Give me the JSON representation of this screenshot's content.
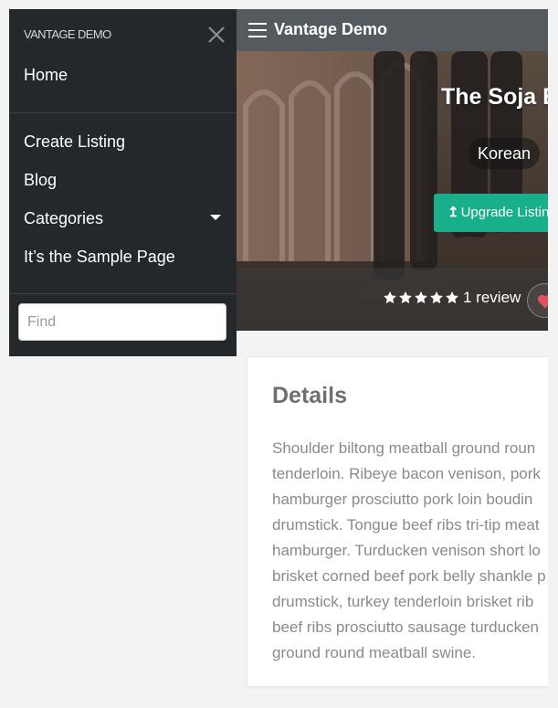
{
  "drawer": {
    "brand": "VANTAGE DEMO",
    "nav": {
      "home": "Home",
      "create_listing": "Create Listing",
      "blog": "Blog",
      "categories": "Categories",
      "sample_page": "It’s the Sample Page"
    },
    "search": {
      "placeholder": "Find",
      "value": ""
    }
  },
  "topbar": {
    "title": "Vantage Demo"
  },
  "listing": {
    "title": "The Soja B",
    "category": "Korean",
    "upgrade_label": "Upgrade Listin",
    "rating": 5,
    "review_count": "1 review"
  },
  "details": {
    "title": "Details",
    "lines": [
      "Shoulder biltong meatball ground roun",
      "tenderloin. Ribeye bacon venison, pork",
      "hamburger prosciutto pork loin boudin",
      "drumstick. Tongue beef ribs tri-tip meat",
      "hamburger. Turducken venison short lo",
      "brisket corned beef pork belly shankle p",
      "drumstick, turkey tenderloin brisket rib",
      "beef ribs prosciutto sausage turducken",
      "ground round meatball swine."
    ]
  },
  "colors": {
    "drawer_bg": "#24282b",
    "topbar_bg": "#555a5f",
    "accent": "#1aaf8b",
    "heart": "#e2525c"
  },
  "icons": {
    "close": "close-icon",
    "menu": "hamburger-menu-icon",
    "dropdown": "caret-down-icon",
    "upgrade": "arrow-up-icon",
    "star": "star-icon",
    "favorite": "heart-icon"
  }
}
